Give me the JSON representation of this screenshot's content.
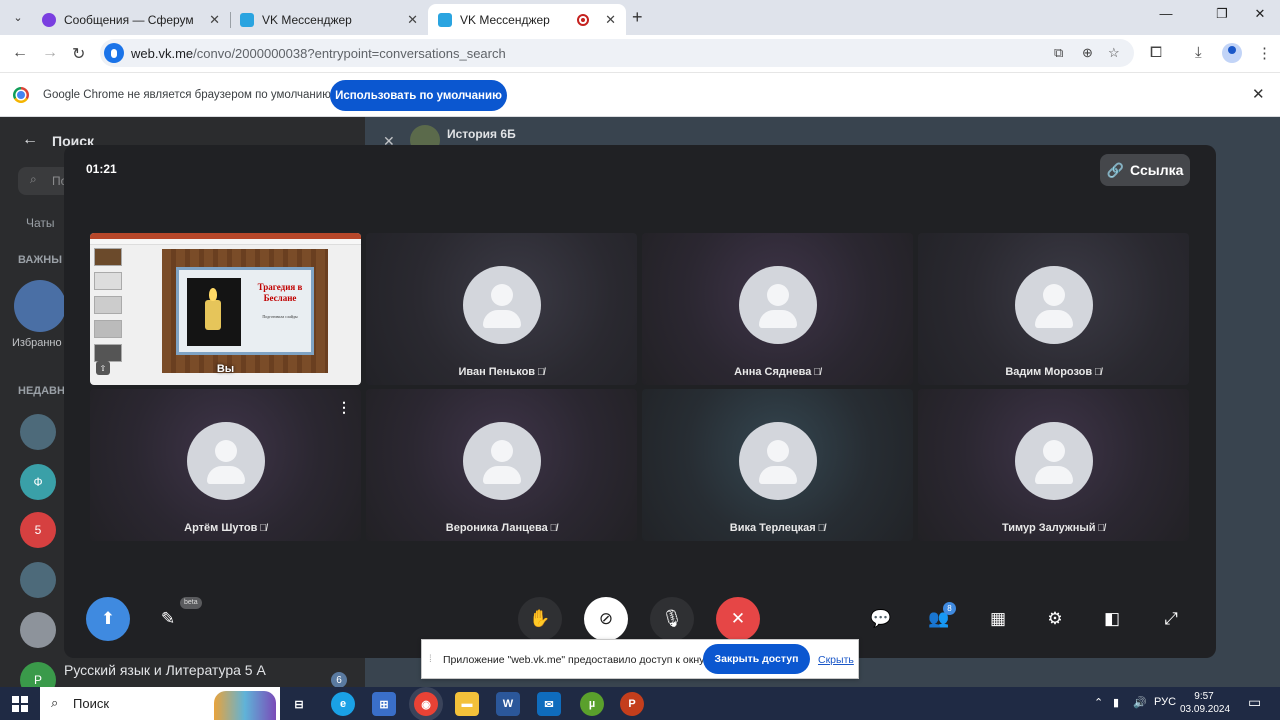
{
  "browser": {
    "tabs": [
      {
        "title": "Сообщения — Сферум",
        "favicon_color": "#7a3fe0"
      },
      {
        "title": "VK Мессенджер",
        "favicon_color": "#2aa4e0"
      },
      {
        "title": "VK Мессенджер",
        "favicon_color": "#2aa4e0",
        "active": true,
        "recording": true
      }
    ],
    "url_host": "web.vk.me",
    "url_path": "/convo/2000000038?entrypoint=conversations_search",
    "infobar": {
      "text": "Google Chrome не является браузером по умолчанию.",
      "button": "Использовать по умолчанию"
    }
  },
  "vk": {
    "search_title": "Поиск",
    "search_placeholder": "По",
    "tab_chats": "Чаты",
    "section_important": "ВАЖНЫ",
    "favorites_label": "Избранно",
    "section_recent": "НЕДАВН",
    "recent_avatars": [
      {
        "letter": "",
        "color": "#4d6a7a"
      },
      {
        "letter": "Ф",
        "color": "#3aa0a8"
      },
      {
        "letter": "5",
        "color": "#d64040"
      },
      {
        "letter": "",
        "color": "#4d6a7a"
      },
      {
        "letter": "",
        "color": "#8d939b"
      },
      {
        "letter": "Р",
        "color": "#3a9a4a"
      }
    ],
    "visible_chat_name": "Русский язык и Литература 5 А",
    "visible_chat_unread": "6",
    "conversation_title": "История 6Б"
  },
  "call": {
    "timer": "01:21",
    "link_button": "Ссылка",
    "self": {
      "name": "Вы",
      "slide_title": "Трагедия в Беслане",
      "slide_subtitle": "Подготовила слайды"
    },
    "participants": [
      {
        "name": "Иван Пеньков",
        "muted": true
      },
      {
        "name": "Анна Сяднева",
        "muted": true
      },
      {
        "name": "Вадим Морозов",
        "muted": true
      },
      {
        "name": "Артём Шутов",
        "muted": true
      },
      {
        "name": "Вероника Ланцева",
        "muted": true
      },
      {
        "name": "Вика Терлецкая",
        "muted": true
      },
      {
        "name": "Тимур Залужный",
        "muted": true
      }
    ],
    "beta_label": "beta",
    "participants_count": "8"
  },
  "share_notice": {
    "text": "Приложение \"web.vk.me\" предоставило доступ к окну.",
    "stop_button": "Закрыть доступ",
    "hide_link": "Скрыть"
  },
  "taskbar": {
    "search_text": "Поиск",
    "language": "РУС",
    "time": "9:57",
    "date": "03.09.2024"
  }
}
